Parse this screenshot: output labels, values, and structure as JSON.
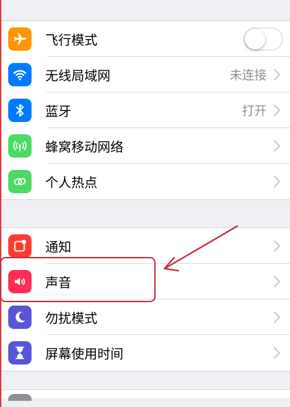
{
  "groups": [
    {
      "items": [
        {
          "label": "飞行模式",
          "icon": "airplane-icon",
          "icon_color": "#ff9500",
          "control": "toggle",
          "toggle_on": false
        },
        {
          "label": "无线局域网",
          "icon": "wifi-icon",
          "icon_color": "#007aff",
          "value": "未连接"
        },
        {
          "label": "蓝牙",
          "icon": "bluetooth-icon",
          "icon_color": "#007aff",
          "value": "打开"
        },
        {
          "label": "蜂窝移动网络",
          "icon": "cellular-antenna-icon",
          "icon_color": "#4cd964"
        },
        {
          "label": "个人热点",
          "icon": "hotspot-link-icon",
          "icon_color": "#4cd964"
        }
      ]
    },
    {
      "items": [
        {
          "label": "通知",
          "icon": "notifications-icon",
          "icon_color": "#ff3b30"
        },
        {
          "label": "声音",
          "icon": "speaker-icon",
          "icon_color": "#ff2d55"
        },
        {
          "label": "勿扰模式",
          "icon": "moon-icon",
          "icon_color": "#5856d6"
        },
        {
          "label": "屏幕使用时间",
          "icon": "hourglass-icon",
          "icon_color": "#5856d6"
        }
      ]
    }
  ],
  "annotation": {
    "highlight_color": "#c0323a",
    "highlighted_item": "声音"
  }
}
